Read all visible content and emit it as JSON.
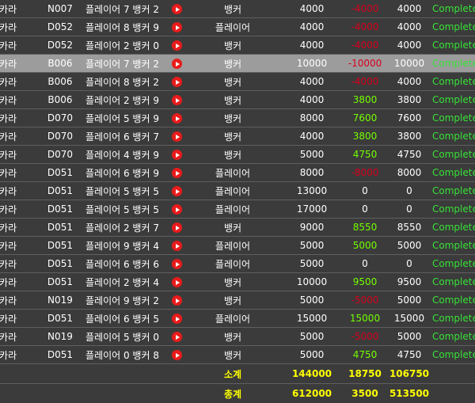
{
  "rows": [
    {
      "game": "바카라",
      "table": "N007",
      "round": "플레이어 7 뱅커 2",
      "bet": "뱅커",
      "amount": "4000",
      "winlose": "-4000",
      "valid": "4000",
      "status": "Complete",
      "sign": "neg"
    },
    {
      "game": "바카라",
      "table": "D052",
      "round": "플레이어 8 뱅커 9",
      "bet": "플레이어",
      "amount": "4000",
      "winlose": "-4000",
      "valid": "4000",
      "status": "Complete",
      "sign": "neg"
    },
    {
      "game": "바카라",
      "table": "D052",
      "round": "플레이어 2 뱅커 0",
      "bet": "뱅커",
      "amount": "4000",
      "winlose": "-4000",
      "valid": "4000",
      "status": "Complete",
      "sign": "neg"
    },
    {
      "game": "바카라",
      "table": "B006",
      "round": "플레이어 7 뱅커 2",
      "bet": "뱅커",
      "amount": "10000",
      "winlose": "-10000",
      "valid": "10000",
      "status": "Complete",
      "sign": "neg",
      "highlight": true
    },
    {
      "game": "바카라",
      "table": "B006",
      "round": "플레이어 8 뱅커 2",
      "bet": "뱅커",
      "amount": "4000",
      "winlose": "-4000",
      "valid": "4000",
      "status": "Complete",
      "sign": "neg"
    },
    {
      "game": "바카라",
      "table": "B006",
      "round": "플레이어 2 뱅커 9",
      "bet": "뱅커",
      "amount": "4000",
      "winlose": "3800",
      "valid": "3800",
      "status": "Complete",
      "sign": "pos"
    },
    {
      "game": "바카라",
      "table": "D070",
      "round": "플레이어 5 뱅커 9",
      "bet": "뱅커",
      "amount": "8000",
      "winlose": "7600",
      "valid": "7600",
      "status": "Complete",
      "sign": "pos"
    },
    {
      "game": "바카라",
      "table": "D070",
      "round": "플레이어 6 뱅커 7",
      "bet": "뱅커",
      "amount": "4000",
      "winlose": "3800",
      "valid": "3800",
      "status": "Complete",
      "sign": "pos"
    },
    {
      "game": "바카라",
      "table": "D070",
      "round": "플레이어 4 뱅커 9",
      "bet": "뱅커",
      "amount": "5000",
      "winlose": "4750",
      "valid": "4750",
      "status": "Complete",
      "sign": "pos"
    },
    {
      "game": "바카라",
      "table": "D051",
      "round": "플레이어 6 뱅커 9",
      "bet": "플레이어",
      "amount": "8000",
      "winlose": "-8000",
      "valid": "8000",
      "status": "Complete",
      "sign": "neg"
    },
    {
      "game": "바카라",
      "table": "D051",
      "round": "플레이어 5 뱅커 5",
      "bet": "플레이어",
      "amount": "13000",
      "winlose": "0",
      "valid": "0",
      "status": "Complete",
      "sign": "zero"
    },
    {
      "game": "바카라",
      "table": "D051",
      "round": "플레이어 5 뱅커 5",
      "bet": "플레이어",
      "amount": "17000",
      "winlose": "0",
      "valid": "0",
      "status": "Complete",
      "sign": "zero"
    },
    {
      "game": "바카라",
      "table": "D051",
      "round": "플레이어 2 뱅커 7",
      "bet": "뱅커",
      "amount": "9000",
      "winlose": "8550",
      "valid": "8550",
      "status": "Complete",
      "sign": "pos"
    },
    {
      "game": "바카라",
      "table": "D051",
      "round": "플레이어 9 뱅커 4",
      "bet": "플레이어",
      "amount": "5000",
      "winlose": "5000",
      "valid": "5000",
      "status": "Complete",
      "sign": "pos"
    },
    {
      "game": "바카라",
      "table": "D051",
      "round": "플레이어 6 뱅커 6",
      "bet": "플레이어",
      "amount": "5000",
      "winlose": "0",
      "valid": "0",
      "status": "Complete",
      "sign": "zero"
    },
    {
      "game": "바카라",
      "table": "D051",
      "round": "플레이어 2 뱅커 4",
      "bet": "뱅커",
      "amount": "10000",
      "winlose": "9500",
      "valid": "9500",
      "status": "Complete",
      "sign": "pos"
    },
    {
      "game": "바카라",
      "table": "N019",
      "round": "플레이어 9 뱅커 2",
      "bet": "뱅커",
      "amount": "5000",
      "winlose": "-5000",
      "valid": "5000",
      "status": "Complete",
      "sign": "neg"
    },
    {
      "game": "바카라",
      "table": "D051",
      "round": "플레이어 6 뱅커 5",
      "bet": "플레이어",
      "amount": "15000",
      "winlose": "15000",
      "valid": "15000",
      "status": "Complete",
      "sign": "pos"
    },
    {
      "game": "바카라",
      "table": "N019",
      "round": "플레이어 5 뱅커 0",
      "bet": "뱅커",
      "amount": "5000",
      "winlose": "-5000",
      "valid": "5000",
      "status": "Complete",
      "sign": "neg"
    },
    {
      "game": "바카라",
      "table": "D051",
      "round": "플레이어 0 뱅커 8",
      "bet": "뱅커",
      "amount": "5000",
      "winlose": "4750",
      "valid": "4750",
      "status": "Complete",
      "sign": "pos"
    }
  ],
  "subtotal": {
    "label": "소계",
    "amount": "144000",
    "winlose": "18750",
    "valid": "106750"
  },
  "total": {
    "label": "총계",
    "amount": "612000",
    "winlose": "3500",
    "valid": "513500"
  },
  "icons": {
    "result": "play-icon"
  },
  "colors": {
    "negative": "#d8001c",
    "positive": "#73ff00",
    "status": "#36e236",
    "summary": "#ffff00",
    "highlight_row": "#9c9c9c"
  }
}
